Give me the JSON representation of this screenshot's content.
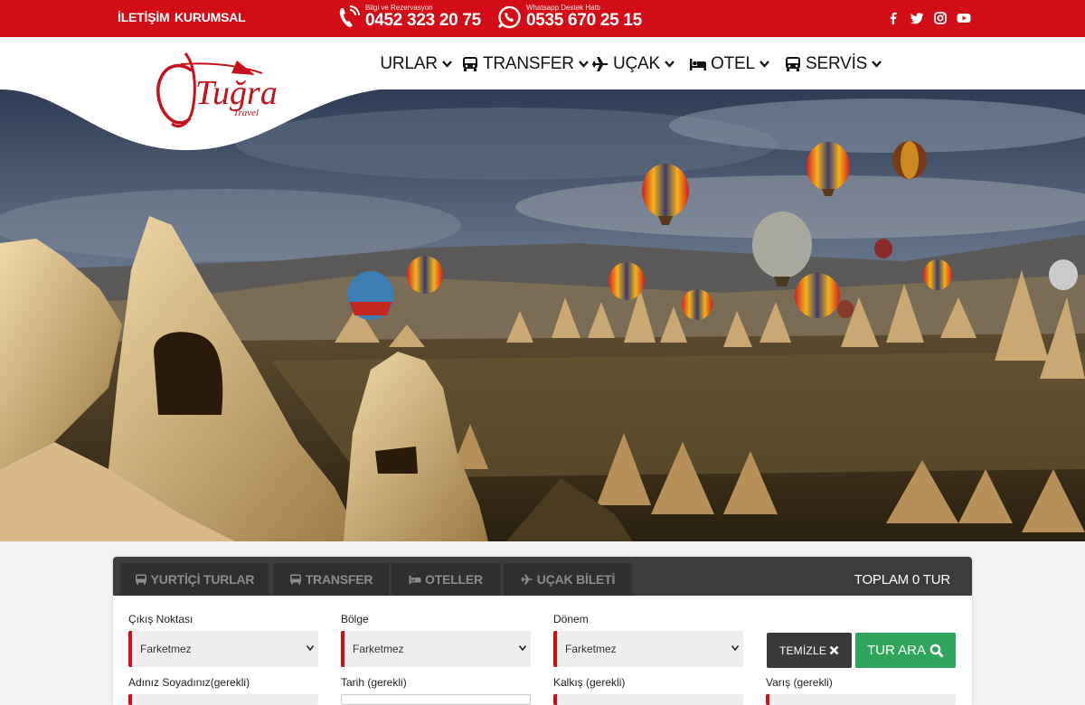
{
  "topbar": {
    "links": [
      "İLETİŞİM",
      "KURUMSAL"
    ],
    "phone": {
      "label": "Bilgi ve Rezervasyon",
      "number": "0452 323 20 75"
    },
    "whatsapp": {
      "label": "Whatsapp Destek Hattı",
      "number": "0535 670 25 15"
    },
    "social_icons": [
      "facebook-icon",
      "twitter-icon",
      "instagram-icon",
      "youtube-icon"
    ]
  },
  "logo": {
    "brand": "Tuğra",
    "sub": "Travel"
  },
  "nav": [
    {
      "label": "TURLAR",
      "icon": "bus-icon"
    },
    {
      "label": "TRANSFER",
      "icon": "bus-icon"
    },
    {
      "label": "UÇAK",
      "icon": "plane-icon"
    },
    {
      "label": "OTEL",
      "icon": "bed-icon"
    },
    {
      "label": "SERVİS",
      "icon": "bus-icon"
    }
  ],
  "search": {
    "tabs": [
      {
        "label": "YURTİÇİ TURLAR",
        "icon": "bus-icon"
      },
      {
        "label": "TRANSFER",
        "icon": "bus-icon"
      },
      {
        "label": "OTELLER",
        "icon": "bed-icon"
      },
      {
        "label": "UÇAK BİLETİ",
        "icon": "plane-icon"
      }
    ],
    "total": "TOPLAM 0 TUR",
    "fields": [
      {
        "label": "Çıkış Noktası",
        "value": "Farketmez"
      },
      {
        "label": "Bölge",
        "value": "Farketmez"
      },
      {
        "label": "Dönem",
        "value": "Farketmez"
      }
    ],
    "fields2": [
      "Adınız Soyadınız(gerekli)",
      "Tarih (gerekli)",
      "Kalkış (gerekli)",
      "Varış (gerekli)"
    ],
    "clear_label": "TEMİZLE",
    "search_label": "TUR ARA"
  },
  "colors": {
    "brand_red": "#d20d17",
    "search_green": "#2ea55a",
    "tab_dark": "#3c3c3c"
  }
}
